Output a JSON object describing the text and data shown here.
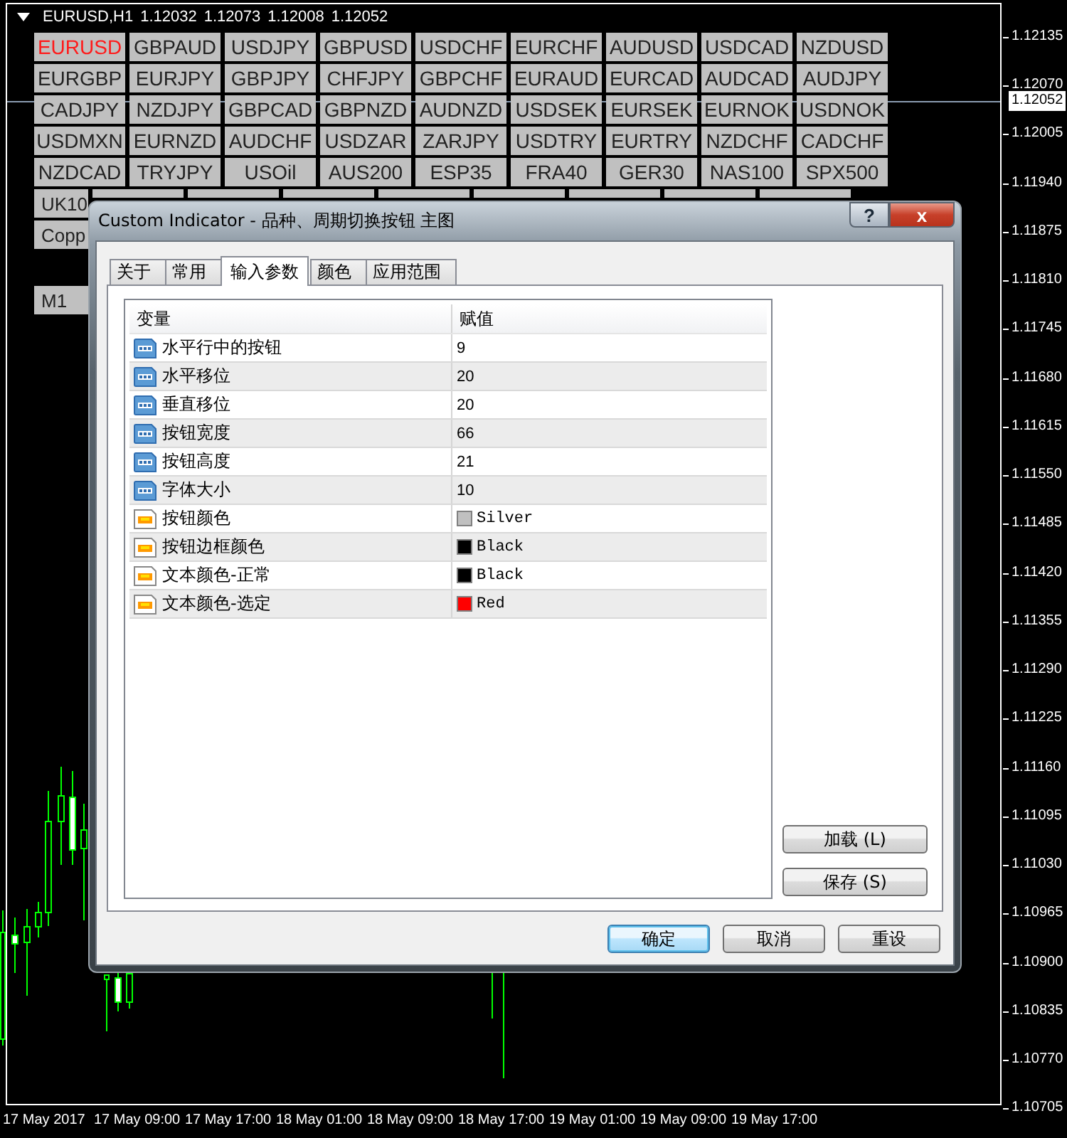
{
  "chart": {
    "symbol": "EURUSD,H1",
    "quotes": [
      "1.12032",
      "1.12073",
      "1.12008",
      "1.12052"
    ]
  },
  "symbol_rows": [
    {
      "buttons": [
        {
          "label": "EURUSD",
          "selected": true,
          "kind": "full"
        },
        {
          "label": "GBPAUD",
          "selected": false,
          "kind": "full"
        },
        {
          "label": "USDJPY",
          "selected": false,
          "kind": "full"
        },
        {
          "label": "GBPUSD",
          "selected": false,
          "kind": "full"
        },
        {
          "label": "USDCHF",
          "selected": false,
          "kind": "full"
        },
        {
          "label": "EURCHF",
          "selected": false,
          "kind": "full"
        },
        {
          "label": "AUDUSD",
          "selected": false,
          "kind": "full"
        },
        {
          "label": "USDCAD",
          "selected": false,
          "kind": "full"
        },
        {
          "label": "NZDUSD",
          "selected": false,
          "kind": "full"
        }
      ]
    },
    {
      "buttons": [
        {
          "label": "EURGBP",
          "selected": false,
          "kind": "full"
        },
        {
          "label": "EURJPY",
          "selected": false,
          "kind": "full"
        },
        {
          "label": "GBPJPY",
          "selected": false,
          "kind": "full"
        },
        {
          "label": "CHFJPY",
          "selected": false,
          "kind": "full"
        },
        {
          "label": "GBPCHF",
          "selected": false,
          "kind": "full"
        },
        {
          "label": "EURAUD",
          "selected": false,
          "kind": "full"
        },
        {
          "label": "EURCAD",
          "selected": false,
          "kind": "full"
        },
        {
          "label": "AUDCAD",
          "selected": false,
          "kind": "full"
        },
        {
          "label": "AUDJPY",
          "selected": false,
          "kind": "full"
        }
      ]
    },
    {
      "buttons": [
        {
          "label": "CADJPY",
          "selected": false,
          "kind": "full"
        },
        {
          "label": "NZDJPY",
          "selected": false,
          "kind": "full"
        },
        {
          "label": "GBPCAD",
          "selected": false,
          "kind": "full"
        },
        {
          "label": "GBPNZD",
          "selected": false,
          "kind": "full"
        },
        {
          "label": "AUDNZD",
          "selected": false,
          "kind": "full"
        },
        {
          "label": "USDSEK",
          "selected": false,
          "kind": "full"
        },
        {
          "label": "EURSEK",
          "selected": false,
          "kind": "full"
        },
        {
          "label": "EURNOK",
          "selected": false,
          "kind": "full"
        },
        {
          "label": "USDNOK",
          "selected": false,
          "kind": "full"
        }
      ]
    },
    {
      "buttons": [
        {
          "label": "USDMXN",
          "selected": false,
          "kind": "full"
        },
        {
          "label": "EURNZD",
          "selected": false,
          "kind": "full"
        },
        {
          "label": "AUDCHF",
          "selected": false,
          "kind": "full"
        },
        {
          "label": "USDZAR",
          "selected": false,
          "kind": "full"
        },
        {
          "label": "ZARJPY",
          "selected": false,
          "kind": "full"
        },
        {
          "label": "USDTRY",
          "selected": false,
          "kind": "full"
        },
        {
          "label": "EURTRY",
          "selected": false,
          "kind": "full"
        },
        {
          "label": "NZDCHF",
          "selected": false,
          "kind": "full"
        },
        {
          "label": "CADCHF",
          "selected": false,
          "kind": "full"
        }
      ]
    },
    {
      "buttons": [
        {
          "label": "NZDCAD",
          "selected": false,
          "kind": "full"
        },
        {
          "label": "TRYJPY",
          "selected": false,
          "kind": "full"
        },
        {
          "label": "USOil",
          "selected": false,
          "kind": "full"
        },
        {
          "label": "AUS200",
          "selected": false,
          "kind": "full"
        },
        {
          "label": "ESP35",
          "selected": false,
          "kind": "full"
        },
        {
          "label": "FRA40",
          "selected": false,
          "kind": "full"
        },
        {
          "label": "GER30",
          "selected": false,
          "kind": "full"
        },
        {
          "label": "NAS100",
          "selected": false,
          "kind": "full"
        },
        {
          "label": "SPX500",
          "selected": false,
          "kind": "full"
        }
      ]
    },
    {
      "buttons": [
        {
          "label": "UK10",
          "selected": false,
          "kind": "partial"
        },
        {
          "kind": "covered"
        },
        {
          "kind": "covered"
        },
        {
          "kind": "covered"
        },
        {
          "kind": "covered"
        },
        {
          "kind": "covered"
        },
        {
          "kind": "covered"
        },
        {
          "kind": "covered"
        },
        {
          "kind": "covered"
        }
      ]
    },
    {
      "buttons": [
        {
          "label": "Copp",
          "selected": false,
          "kind": "partial"
        }
      ]
    }
  ],
  "timeframe_buttons": [
    {
      "label": "M1",
      "selected": false,
      "kind": "partial"
    }
  ],
  "price_axis": {
    "labels": [
      "1.12135",
      "1.12070",
      "1.12005",
      "1.11940",
      "1.11875",
      "1.11810",
      "1.11745",
      "1.11680",
      "1.11615",
      "1.11550",
      "1.11485",
      "1.11420",
      "1.11355",
      "1.11290",
      "1.11225",
      "1.11160",
      "1.11095",
      "1.11030",
      "1.10965",
      "1.10900",
      "1.10835",
      "1.10770",
      "1.10705"
    ],
    "current_price": "1.12052"
  },
  "time_axis": {
    "labels": [
      "17 May 2017",
      "17 May 09:00",
      "17 May 17:00",
      "18 May 01:00",
      "18 May 09:00",
      "18 May 17:00",
      "19 May 01:00",
      "19 May 09:00",
      "19 May 17:00"
    ]
  },
  "dialog": {
    "title": "Custom Indicator - 品种、周期切换按钮 主图",
    "help": "?",
    "close": "x",
    "tabs": [
      {
        "label": "关于",
        "selected": false
      },
      {
        "label": "常用",
        "selected": false
      },
      {
        "label": "输入参数",
        "selected": true
      },
      {
        "label": "颜色",
        "selected": false
      },
      {
        "label": "应用范围",
        "selected": false
      }
    ],
    "table": {
      "columns": [
        "变量",
        "赋值"
      ],
      "rows": [
        {
          "kind": "number",
          "name": "水平行中的按钮",
          "value": "9"
        },
        {
          "kind": "number",
          "name": "水平移位",
          "value": "20"
        },
        {
          "kind": "number",
          "name": "垂直移位",
          "value": "20"
        },
        {
          "kind": "number",
          "name": "按钮宽度",
          "value": "66"
        },
        {
          "kind": "number",
          "name": "按钮高度",
          "value": "21"
        },
        {
          "kind": "number",
          "name": "字体大小",
          "value": "10"
        },
        {
          "kind": "color",
          "name": "按钮颜色",
          "value": "Silver",
          "color": "#c0c0c0"
        },
        {
          "kind": "color",
          "name": "按钮边框颜色",
          "value": "Black",
          "color": "#000000"
        },
        {
          "kind": "color",
          "name": "文本颜色-正常",
          "value": "Black",
          "color": "#000000"
        },
        {
          "kind": "color",
          "name": "文本颜色-选定",
          "value": "Red",
          "color": "#ff0000"
        }
      ]
    },
    "side_buttons": [
      "加载 (L)",
      "保存 (S)"
    ],
    "buttons": [
      {
        "label": "确定",
        "focused": true
      },
      {
        "label": "取消",
        "focused": false
      },
      {
        "label": "重设",
        "focused": false
      }
    ]
  }
}
